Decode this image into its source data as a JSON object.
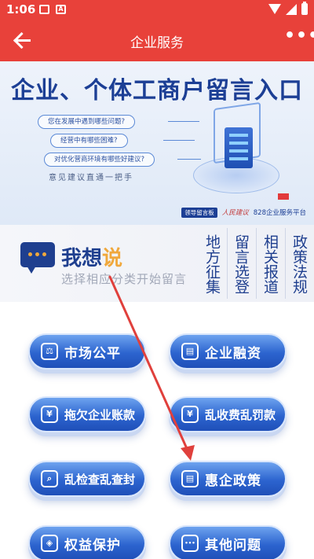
{
  "status_bar": {
    "time": "1:06",
    "left_icons": [
      "image-icon",
      "a-badge-icon"
    ],
    "right_icons": [
      "wifi-icon",
      "signal-icon",
      "battery-icon"
    ]
  },
  "header": {
    "title": "企业服务",
    "back_icon": "arrow-left-icon",
    "more_icon": "more-dots-icon",
    "more_glyph": "•••",
    "color": "#e8413a"
  },
  "banner": {
    "title": "企业、个体工商户留言入口",
    "questions": [
      "您在发展中遇到哪些问题?",
      "经营中有哪些困难?",
      "对优化营商环境有哪些好建议?"
    ],
    "subtitle": "意见建议直通一把手",
    "footer": {
      "logo_text": "领导留言板",
      "signature": "人民建议",
      "platform": "828企业服务平台"
    }
  },
  "say_section": {
    "title_main": "我想",
    "title_highlight": "说",
    "subtitle": "选择相应分类开始留言",
    "tabs": [
      "地方征集",
      "留言选登",
      "相关报道",
      "政策法规"
    ]
  },
  "categories": [
    {
      "label": "市场公平",
      "icon": "scale-icon",
      "glyph": "⚖"
    },
    {
      "label": "企业融资",
      "icon": "document-icon",
      "glyph": "▤"
    },
    {
      "label": "拖欠企业账款",
      "icon": "invoice-icon",
      "glyph": "¥"
    },
    {
      "label": "乱收费乱罚款",
      "icon": "yen-icon",
      "glyph": "¥"
    },
    {
      "label": "乱检查乱查封",
      "icon": "search-icon",
      "glyph": "⌕"
    },
    {
      "label": "惠企政策",
      "icon": "policy-icon",
      "glyph": "▤"
    },
    {
      "label": "权益保护",
      "icon": "shield-icon",
      "glyph": "◈"
    },
    {
      "label": "其他问题",
      "icon": "dots-icon",
      "glyph": "•••"
    }
  ],
  "colors": {
    "accent_red": "#e8413a",
    "brand_blue": "#1f3f8f",
    "highlight_orange": "#f0a83c",
    "button_blue": "#2c64cf"
  }
}
